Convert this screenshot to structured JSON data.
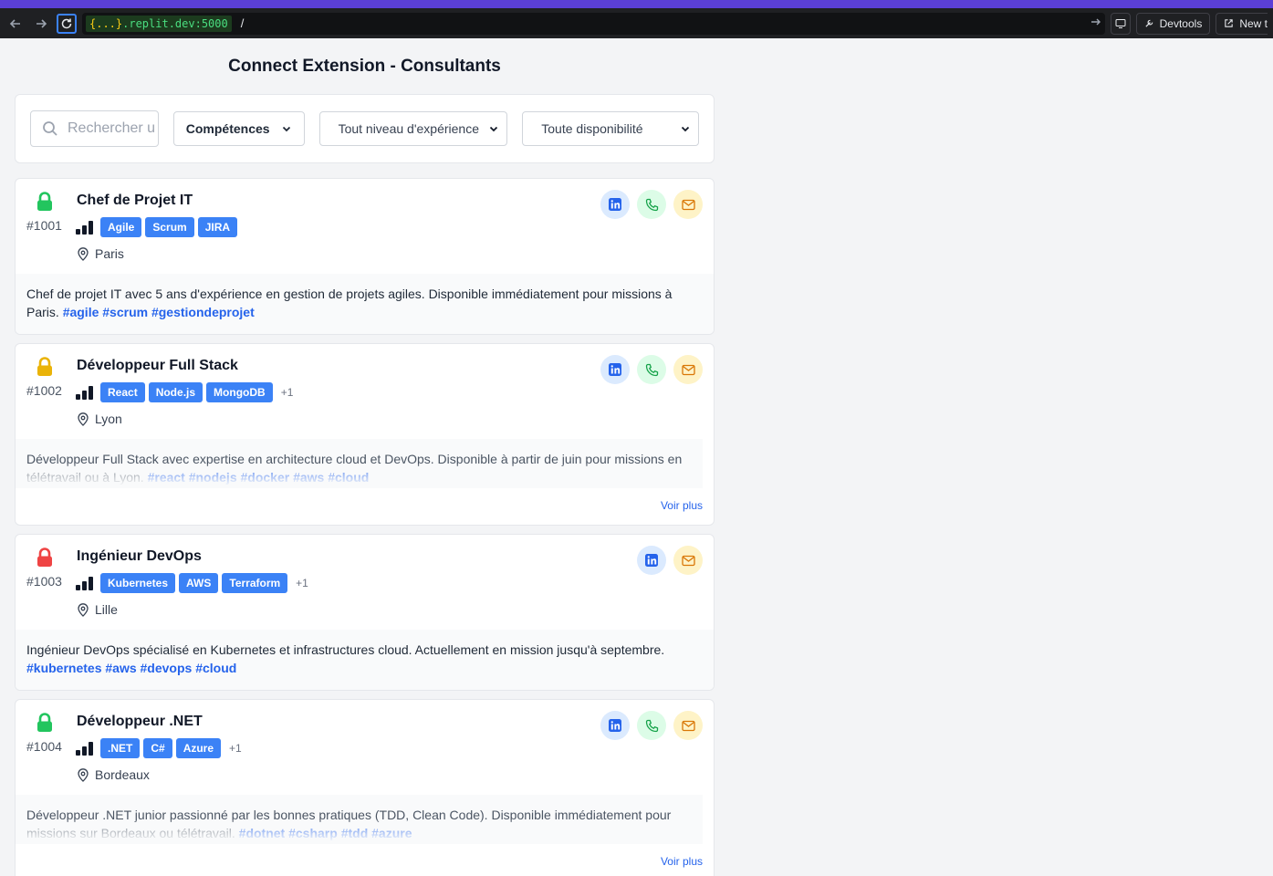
{
  "browser": {
    "url_host_template": "{...}",
    "url_host": ".replit.dev:5000",
    "url_path": "/",
    "devtools_label": "Devtools",
    "new_tab_label": "New t"
  },
  "page": {
    "title": "Connect Extension - Consultants"
  },
  "filters": {
    "search_placeholder": "Rechercher u",
    "competences_label": "Compétences",
    "experience_selected": "Tout niveau d'expérience",
    "disponibilite_selected": "Toute disponibilité"
  },
  "colors": {
    "lock_available": "#22c55e",
    "lock_soon": "#eab308",
    "lock_busy": "#ef4444",
    "tag": "#3b82f6",
    "link": "#2563eb"
  },
  "consultants": [
    {
      "id": "#1001",
      "title": "Chef de Projet IT",
      "status": "available",
      "tags": [
        "Agile",
        "Scrum",
        "JIRA"
      ],
      "more": "",
      "location": "Paris",
      "description": "Chef de projet IT avec 5 ans d'expérience en gestion de projets agiles. Disponible immédiatement pour missions à Paris.",
      "hashtags": "#agile #scrum #gestiondeprojet",
      "actions": [
        "linkedin-icon",
        "phone-icon",
        "mail-icon"
      ],
      "show_more": ""
    },
    {
      "id": "#1002",
      "title": "Développeur Full Stack",
      "status": "soon",
      "tags": [
        "React",
        "Node.js",
        "MongoDB"
      ],
      "more": "+1",
      "location": "Lyon",
      "description": "Développeur Full Stack avec expertise en architecture cloud et DevOps. Disponible à partir de juin pour missions en télétravail ou à Lyon.",
      "hashtags": "#react #nodejs #docker #aws #cloud",
      "actions": [
        "linkedin-icon",
        "phone-icon",
        "mail-icon"
      ],
      "show_more": "Voir plus"
    },
    {
      "id": "#1003",
      "title": "Ingénieur DevOps",
      "status": "busy",
      "tags": [
        "Kubernetes",
        "AWS",
        "Terraform"
      ],
      "more": "+1",
      "location": "Lille",
      "description": "Ingénieur DevOps spécialisé en Kubernetes et infrastructures cloud. Actuellement en mission jusqu'à septembre.",
      "hashtags": "#kubernetes #aws #devops #cloud",
      "actions": [
        "linkedin-icon",
        "mail-icon"
      ],
      "show_more": ""
    },
    {
      "id": "#1004",
      "title": "Développeur .NET",
      "status": "available",
      "tags": [
        ".NET",
        "C#",
        "Azure"
      ],
      "more": "+1",
      "location": "Bordeaux",
      "description": "Développeur .NET junior passionné par les bonnes pratiques (TDD, Clean Code). Disponible immédiatement pour missions sur Bordeaux ou télétravail.",
      "hashtags": "#dotnet #csharp #tdd #azure",
      "actions": [
        "linkedin-icon",
        "phone-icon",
        "mail-icon"
      ],
      "show_more": "Voir plus"
    }
  ]
}
